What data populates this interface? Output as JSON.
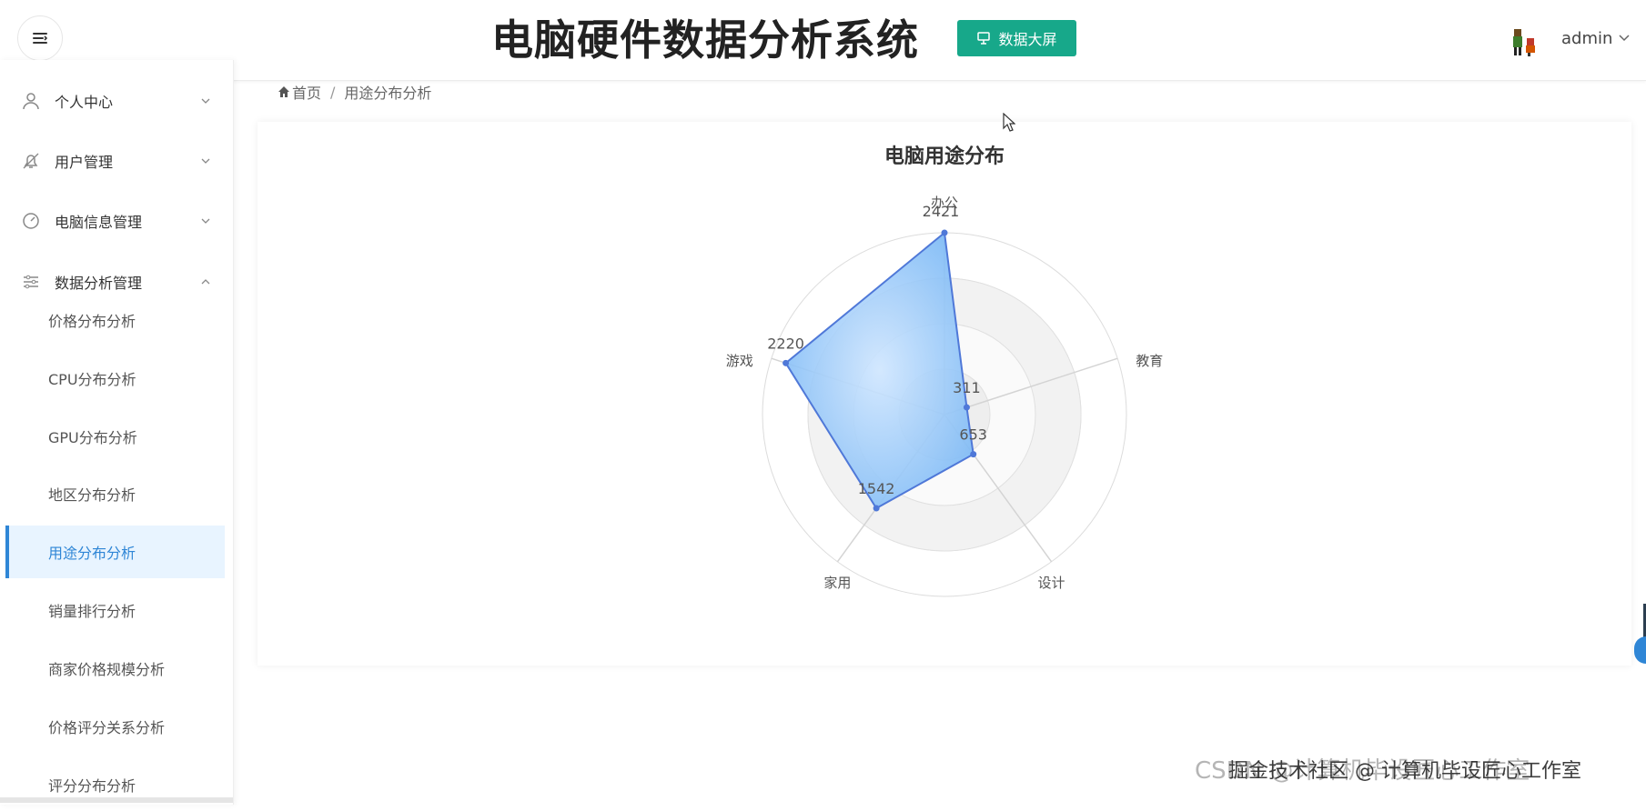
{
  "header": {
    "title": "电脑硬件数据分析系统",
    "big_screen_label": "数据大屏",
    "username": "admin"
  },
  "sidebar": {
    "groups": [
      {
        "label": "个人中心",
        "icon": "user-icon",
        "expanded": false
      },
      {
        "label": "用户管理",
        "icon": "bell-icon",
        "expanded": false
      },
      {
        "label": "电脑信息管理",
        "icon": "gauge-icon",
        "expanded": false
      },
      {
        "label": "数据分析管理",
        "icon": "sliders-icon",
        "expanded": true
      }
    ],
    "items": [
      {
        "label": "价格分布分析"
      },
      {
        "label": "CPU分布分析"
      },
      {
        "label": "GPU分布分析"
      },
      {
        "label": "地区分布分析"
      },
      {
        "label": "用途分布分析",
        "active": true
      },
      {
        "label": "销量排行分析"
      },
      {
        "label": "商家价格规模分析"
      },
      {
        "label": "价格评分关系分析"
      },
      {
        "label": "评分分布分析"
      }
    ]
  },
  "breadcrumb": {
    "home": "首页",
    "current": "用途分布分析"
  },
  "chart_data": {
    "type": "radar",
    "title": "电脑用途分布",
    "indicators": [
      "办公",
      "教育",
      "设计",
      "家用",
      "游戏"
    ],
    "values": [
      2421,
      311,
      653,
      1542,
      2220
    ],
    "max": 2421,
    "fill_color": "#7ab8f5",
    "line_color": "#4f78d8"
  },
  "watermark": {
    "primary": "掘金技术社区 @ 计算机毕设匠心工作室",
    "secondary": "CSDN @计算机毕设匠心工作室"
  },
  "colors": {
    "accent": "#17a88a",
    "active": "#2f86d6"
  }
}
